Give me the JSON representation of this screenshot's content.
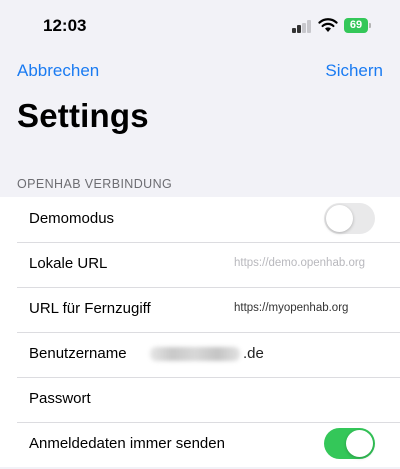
{
  "status_bar": {
    "time": "12:03",
    "battery_percent": "69",
    "icons": [
      "cellular-signal-icon",
      "wifi-icon",
      "battery-icon"
    ]
  },
  "nav": {
    "cancel_label": "Abbrechen",
    "save_label": "Sichern"
  },
  "title": "Settings",
  "section": {
    "header": "OPENHAB VERBINDUNG",
    "rows": {
      "demo": {
        "label": "Demomodus",
        "enabled": false
      },
      "local_url": {
        "label": "Lokale URL",
        "value": "https://demo.openhab.org"
      },
      "remote_url": {
        "label": "URL für Fernzugiff",
        "value": "https://myopenhab.org"
      },
      "username": {
        "label": "Benutzername",
        "value_visible": ".de"
      },
      "password": {
        "label": "Passwort",
        "value": ""
      },
      "always_send": {
        "label": "Anmeldedaten immer senden",
        "enabled": true
      }
    }
  },
  "colors": {
    "accent": "#1a7bf2",
    "toggle_on": "#34c759",
    "toggle_off": "#e9e9ea",
    "background": "#f2f2f7"
  }
}
